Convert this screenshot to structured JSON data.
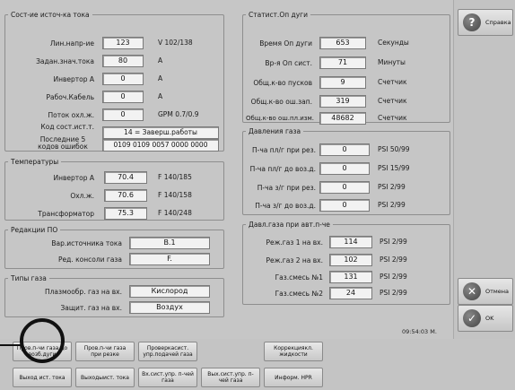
{
  "source_group": {
    "title": "Сост-ие источ-ка тока",
    "rows": [
      {
        "label": "Лин.напр-ие",
        "value": "123",
        "unit": "V 102/138"
      },
      {
        "label": "Задан.знач.тока",
        "value": "80",
        "unit": "A"
      },
      {
        "label": "Инвертор А",
        "value": "0",
        "unit": "A"
      },
      {
        "label": "Рабоч.Кабель",
        "value": "0",
        "unit": "A"
      },
      {
        "label": "Поток охл.ж.",
        "value": "0",
        "unit": "GPM 0.7/0.9"
      }
    ],
    "status_code_label": "Код сост.ист.т.",
    "status_code_value": "14 = Заверш.работы",
    "last_errors_label": "Последние 5 кодов ошибок",
    "last_errors_value": "0109 0109 0057 0000 0000"
  },
  "temps_group": {
    "title": "Температуры",
    "rows": [
      {
        "label": "Инвертор А",
        "value": "70.4",
        "unit": "F 140/185"
      },
      {
        "label": "Охл.ж.",
        "value": "70.6",
        "unit": "F 140/158"
      },
      {
        "label": "Трансформатор",
        "value": "75.3",
        "unit": "F 140/248"
      }
    ]
  },
  "versions_group": {
    "title": "Редакции ПО",
    "rows": [
      {
        "label": "Вар.источника тока",
        "value": "B.1"
      },
      {
        "label": "Ред. консоли газа",
        "value": "F."
      }
    ]
  },
  "gas_types_group": {
    "title": "Типы газа",
    "rows": [
      {
        "label": "Плазмообр. газ на вх.",
        "value": "Кислород"
      },
      {
        "label": "Защит. газ на вх.",
        "value": "Воздух"
      }
    ]
  },
  "arc_stats_group": {
    "title": "Статист.Оп дуги",
    "rows": [
      {
        "label": "Время Оп дуги",
        "value": "653",
        "unit": "Секунды"
      },
      {
        "label": "Вр-я Оп сист.",
        "value": "71",
        "unit": "Минуты"
      },
      {
        "label": "Общ.к-во пусков",
        "value": "9",
        "unit": "Счетчик"
      },
      {
        "label": "Общ.к-во ош.зап.",
        "value": "319",
        "unit": "Счетчик"
      },
      {
        "label": "Общ.к-во ош.пл.изм.",
        "value": "48682",
        "unit": "Счетчик"
      }
    ]
  },
  "gas_pressure_group": {
    "title": "Давления газа",
    "rows": [
      {
        "label": "П-ча пл/г при рез.",
        "value": "0",
        "unit": "PSI 50/99"
      },
      {
        "label": "П-ча пл/г до воз.д.",
        "value": "0",
        "unit": "PSI 15/99"
      },
      {
        "label": "П-ча з/г при рез.",
        "value": "0",
        "unit": "PSI 2/99"
      },
      {
        "label": "П-ча з/г до воз.д.",
        "value": "0",
        "unit": "PSI 2/99"
      }
    ]
  },
  "auto_gas_group": {
    "title": "Давл.газа при авт.п-че",
    "rows": [
      {
        "label": "Реж.газ 1 на вх.",
        "value": "114",
        "unit": "PSI 2/99"
      },
      {
        "label": "Реж.газ 2 на вх.",
        "value": "102",
        "unit": "PSI 2/99"
      },
      {
        "label": "Газ.смесь №1",
        "value": "131",
        "unit": "PSI 2/99"
      },
      {
        "label": "Газ.смесь №2",
        "value": "24",
        "unit": "PSI 2/99"
      }
    ]
  },
  "timestamp": "09:54:03 M.",
  "right_buttons": {
    "help": {
      "label": "Справка",
      "icon": "question-icon"
    },
    "cancel": {
      "label": "Отмена",
      "icon": "close-icon"
    },
    "ok": {
      "label": "OK",
      "icon": "check-icon"
    }
  },
  "bottom_buttons_row1": [
    "Пров.п-чи газа до возб.дуги",
    "Пров.п-чи газа при резке",
    "Проверкасист. упр.подачей газа",
    "Коррекциякл. жидкости"
  ],
  "bottom_buttons_row2": [
    "Выход ист. тока",
    "Выходыист. тока",
    "Вх.сист.упр. п-чей газа",
    "Вых.сист.упр. п-чей газа",
    "Информ. HPR"
  ]
}
